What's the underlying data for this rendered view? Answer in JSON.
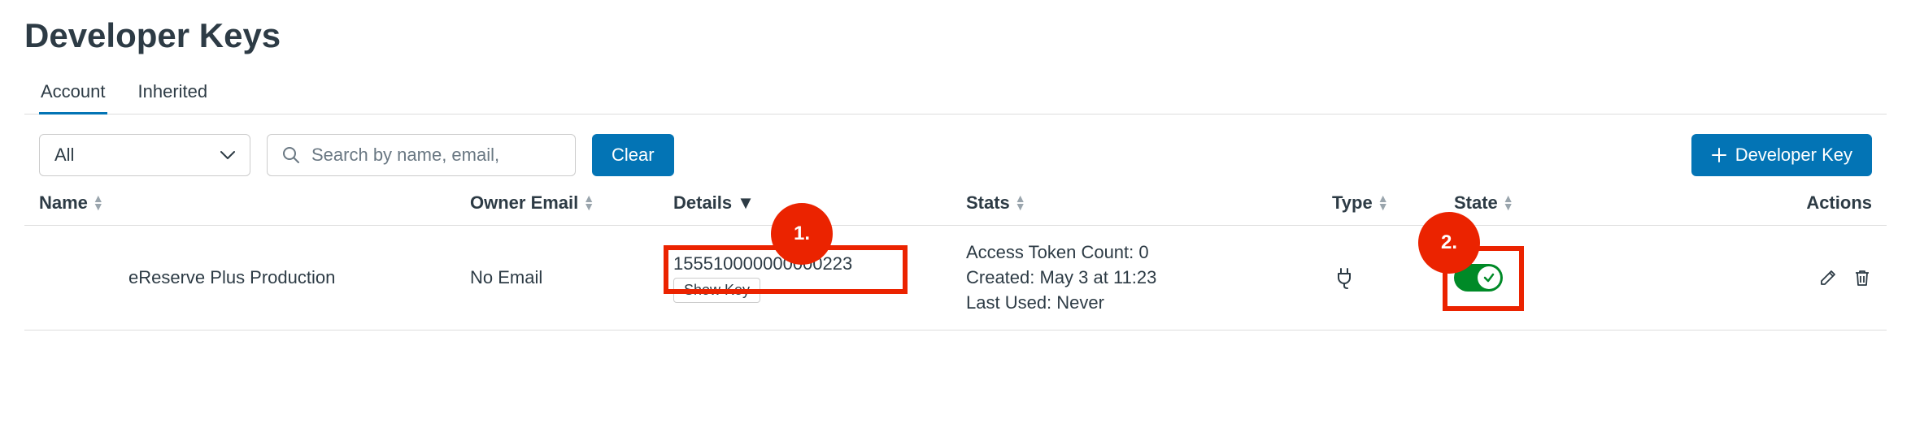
{
  "page": {
    "title": "Developer Keys"
  },
  "tabs": {
    "account": "Account",
    "inherited": "Inherited"
  },
  "filter": {
    "selected": "All",
    "searchPlaceholder": "Search by name, email,",
    "clear": "Clear",
    "addButton": "Developer Key"
  },
  "columns": {
    "name": "Name",
    "email": "Owner Email",
    "details": "Details",
    "stats": "Stats",
    "type": "Type",
    "state": "State",
    "actions": "Actions"
  },
  "row": {
    "name": "eReserve Plus Production",
    "email": "No Email",
    "detailsId": "155510000000000223",
    "showKey": "Show Key",
    "stats": {
      "tokenCount": "Access Token Count: 0",
      "created": "Created: May 3 at 11:23",
      "lastUsed": "Last Used: Never"
    },
    "stateOn": true
  },
  "annotations": {
    "one": "1.",
    "two": "2."
  }
}
